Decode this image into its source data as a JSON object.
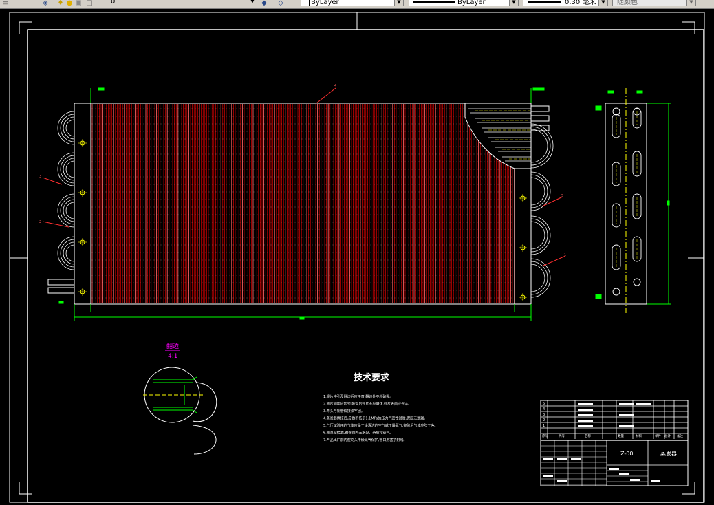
{
  "toolbar": {
    "layer_name": "0",
    "color_value": "ByLayer",
    "linetype_value": "ByLayer",
    "lineweight_value": "0.30 毫米",
    "plotstyle_value": "随颜色",
    "icons": [
      "layer-manager-icon",
      "bulb-icon",
      "sun-icon",
      "lock-icon",
      "layer-color-icon",
      "make-current-icon",
      "layer-previous-icon"
    ]
  },
  "drawing": {
    "tech_title": "技术要求",
    "tech_notes": [
      "1.翅片冲孔及翻边后应平直,翻边处不应破裂。",
      "2.翅片间距应均匀,胀管后翅片不应倒伏,翅片表面应光洁。",
      "3.弯头与铜管焊接须牢固。",
      "4.蒸发器焊接后,应做不低于1.1MPa的压力气密性试验,保压无泄漏。",
      "5.气压试验用的气体应是干燥清洁的空气或干燥氮气,实验后气体应吹干净。",
      "6.抽真空检漏,确保管内无水分、杂质和空气。",
      "7.产品出厂前内腔充入干燥氮气保护,管口用塞子封堵。"
    ],
    "detail_label": "翻边",
    "detail_scale": "4:1",
    "balloons": [
      "4",
      "3",
      "2",
      "5",
      "1"
    ],
    "title_block": {
      "drawing_no": "Z-00",
      "part_name": "蒸发器",
      "row_numbers": [
        "5",
        "4",
        "3",
        "2",
        "1"
      ],
      "header_labels": [
        "序号",
        "代号",
        "名称",
        "数量",
        "材料",
        "单件",
        "总计",
        "备注"
      ]
    }
  },
  "colors": {
    "background": "#000000",
    "fins": "#ff0000",
    "outline": "#ffffff",
    "dimension": "#00ff00",
    "centerline": "#ffff00",
    "detail_text": "#ff00ff",
    "leader": "#ff0000"
  }
}
